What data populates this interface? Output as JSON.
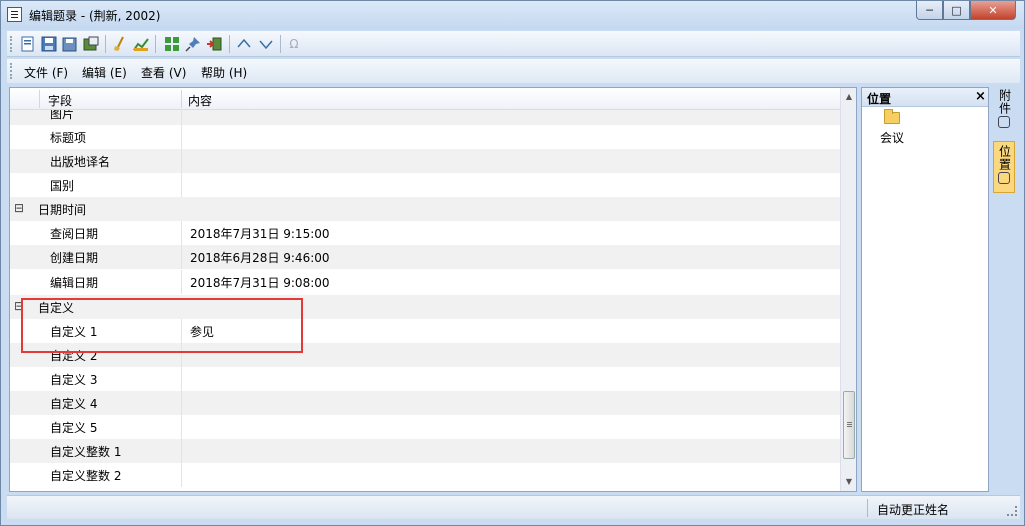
{
  "window": {
    "title": "编辑题录 - (荆新, 2002)",
    "minimize": "─",
    "maximize": "□",
    "close": "✕"
  },
  "toolbar": {
    "icons": [
      "new-record-icon",
      "save-icon",
      "save-as-icon",
      "export-icon",
      "clear-icon",
      "chart-icon",
      "grid-icon",
      "pin-icon",
      "import-icon",
      "move-up-icon",
      "move-down-icon",
      "omega-icon"
    ]
  },
  "menu": {
    "file": "文件 (F)",
    "edit": "编辑 (E)",
    "view": "查看 (V)",
    "help": "帮助 (H)"
  },
  "grid": {
    "headers": {
      "field": "字段",
      "content": "内容"
    },
    "rows": [
      {
        "field": "图片",
        "content": ""
      },
      {
        "field": "标题项",
        "content": ""
      },
      {
        "field": "出版地译名",
        "content": ""
      },
      {
        "field": "国别",
        "content": ""
      },
      {
        "group": "日期时间",
        "expander": "⊟"
      },
      {
        "field": "查阅日期",
        "content": "2018年7月31日 9:15:00"
      },
      {
        "field": "创建日期",
        "content": "2018年6月28日 9:46:00"
      },
      {
        "field": "编辑日期",
        "content": "2018年7月31日 9:08:00"
      },
      {
        "group": "自定义",
        "expander": "⊟"
      },
      {
        "field": "自定义 1",
        "content": "参见"
      },
      {
        "field": "自定义 2",
        "content": ""
      },
      {
        "field": "自定义 3",
        "content": ""
      },
      {
        "field": "自定义 4",
        "content": ""
      },
      {
        "field": "自定义 5",
        "content": ""
      },
      {
        "field": "自定义整数 1",
        "content": ""
      },
      {
        "field": "自定义整数 2",
        "content": ""
      }
    ]
  },
  "side_panel": {
    "title": "位置",
    "close": "×",
    "tree_item": "会议"
  },
  "vertical_tabs": [
    {
      "label": "附件"
    },
    {
      "label": "位置"
    }
  ],
  "status": {
    "text": "自动更正姓名"
  },
  "colors": {
    "highlight_border": "#e53935",
    "active_tab": "#fbd77e"
  }
}
